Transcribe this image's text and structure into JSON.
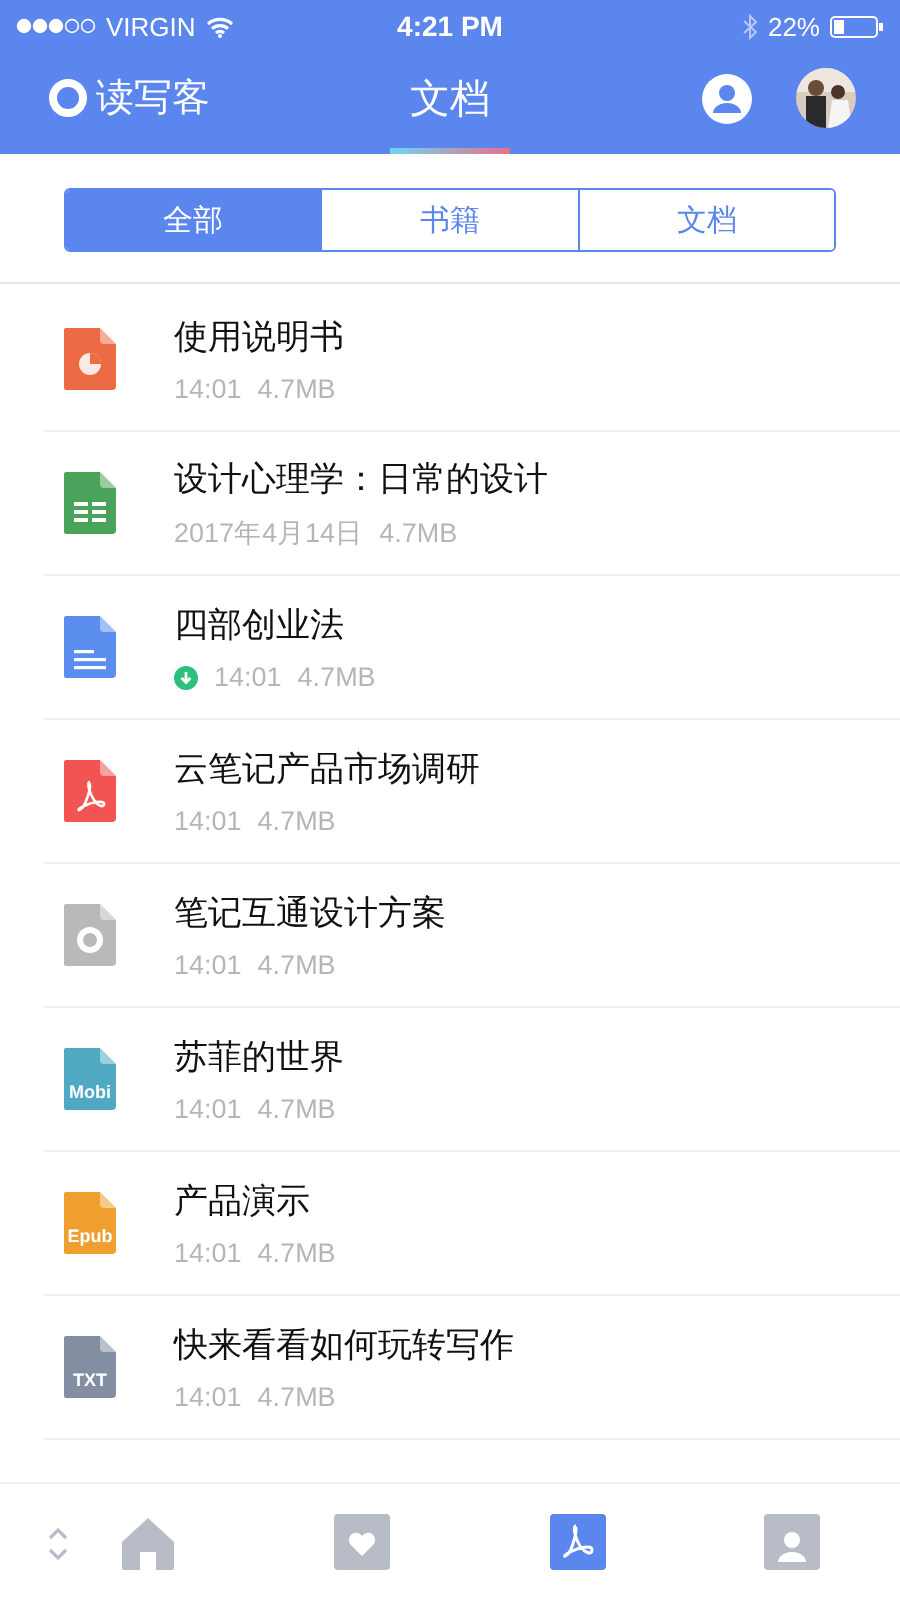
{
  "status_bar": {
    "carrier": "VIRGIN",
    "time": "4:21 PM",
    "battery": "22%"
  },
  "nav": {
    "logo": "读写客",
    "title": "文档"
  },
  "segments": [
    {
      "label": "全部",
      "selected": true
    },
    {
      "label": "书籍",
      "selected": false
    },
    {
      "label": "文档",
      "selected": false
    }
  ],
  "files": [
    {
      "kind": "ppt",
      "name": "使用说明书",
      "date": "14:01",
      "size": "4.7MB",
      "downloaded": false
    },
    {
      "kind": "sheet",
      "name": "设计心理学：日常的设计",
      "date": "2017年4月14日",
      "size": "4.7MB",
      "downloaded": false
    },
    {
      "kind": "doc",
      "name": "四部创业法",
      "date": "14:01",
      "size": "4.7MB",
      "downloaded": true
    },
    {
      "kind": "pdf",
      "name": "云笔记产品市场调研",
      "date": "14:01",
      "size": "4.7MB",
      "downloaded": false
    },
    {
      "kind": "other",
      "name": "笔记互通设计方案",
      "date": "14:01",
      "size": "4.7MB",
      "downloaded": false
    },
    {
      "kind": "mobi",
      "badge": "Mobi",
      "name": "苏菲的世界",
      "date": "14:01",
      "size": "4.7MB",
      "downloaded": false
    },
    {
      "kind": "epub",
      "badge": "Epub",
      "name": "产品演示",
      "date": "14:01",
      "size": "4.7MB",
      "downloaded": false
    },
    {
      "kind": "txt",
      "badge": "TXT",
      "name": "快来看看如何玩转写作",
      "date": "14:01",
      "size": "4.7MB",
      "downloaded": false
    }
  ],
  "tab_bar": [
    {
      "kind": "home",
      "selected": false
    },
    {
      "kind": "heart",
      "selected": false
    },
    {
      "kind": "pdf",
      "selected": true
    },
    {
      "kind": "reader",
      "selected": false
    }
  ]
}
